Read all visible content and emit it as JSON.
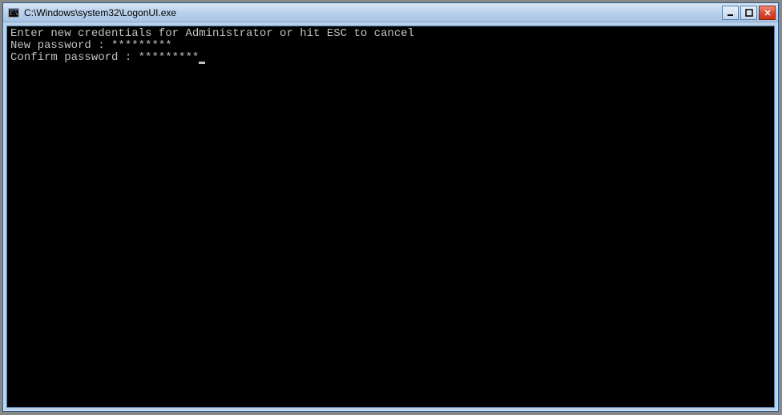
{
  "window": {
    "title": "C:\\Windows\\system32\\LogonUI.exe"
  },
  "console": {
    "line1": "Enter new credentials for Administrator or hit ESC to cancel",
    "line2_label": "New password : ",
    "line2_value": "*********",
    "line3_label": "Confirm password : ",
    "line3_value": "*********"
  }
}
